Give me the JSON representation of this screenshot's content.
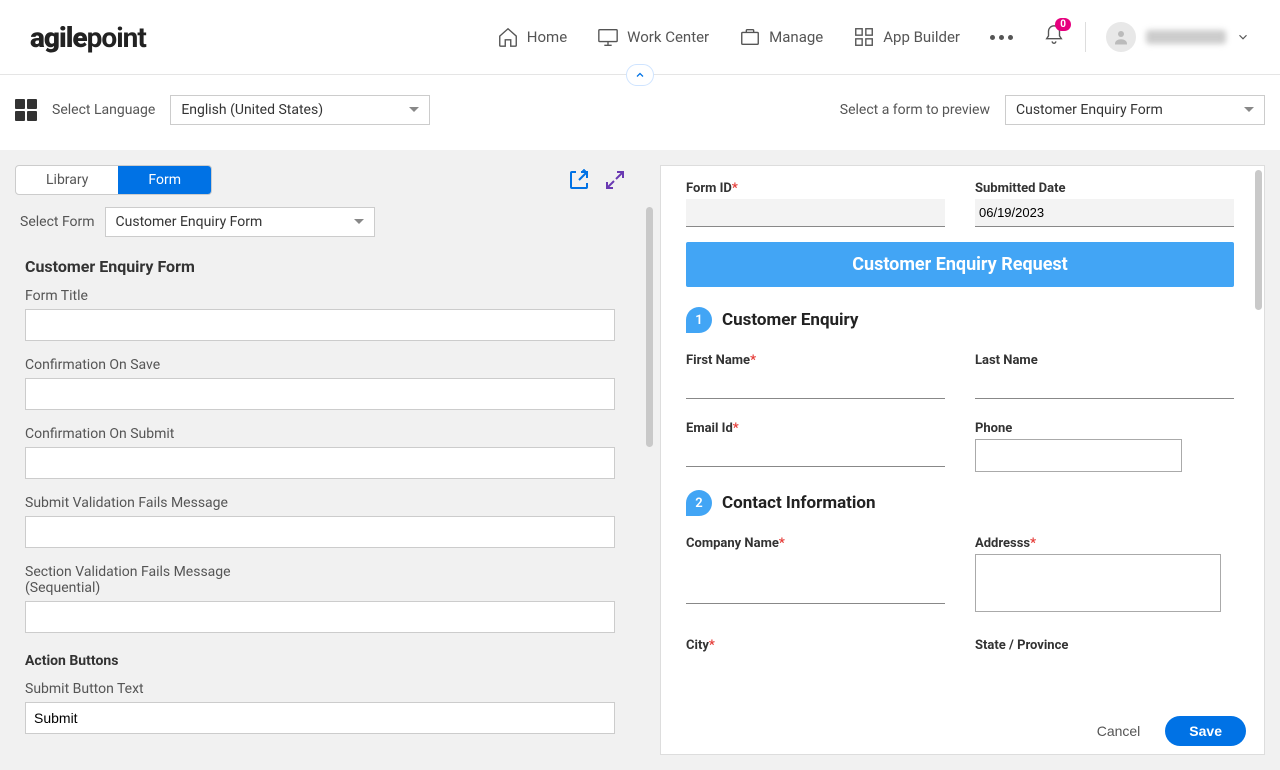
{
  "header": {
    "logo": "agilepoint",
    "nav": [
      "Home",
      "Work Center",
      "Manage",
      "App Builder"
    ],
    "notif_count": "0"
  },
  "subbar": {
    "lang_label": "Select Language",
    "lang_value": "English (United States)",
    "preview_label": "Select a form to preview",
    "preview_value": "Customer Enquiry Form"
  },
  "tabs": {
    "library": "Library",
    "form": "Form"
  },
  "left": {
    "select_form_label": "Select Form",
    "select_form_value": "Customer Enquiry Form",
    "section_title": "Customer Enquiry Form",
    "fields": {
      "form_title": "Form Title",
      "conf_save": "Confirmation On Save",
      "conf_submit": "Confirmation On Submit",
      "submit_fail": "Submit Validation Fails Message",
      "section_fail_1": "Section Validation Fails Message",
      "section_fail_2": "(Sequential)"
    },
    "action_buttons": "Action Buttons",
    "submit_text_label": "Submit Button Text",
    "submit_text_value": "Submit"
  },
  "preview": {
    "form_id_label": "Form ID",
    "submitted_label": "Submitted Date",
    "submitted_value": "06/19/2023",
    "banner": "Customer Enquiry Request",
    "step1": "Customer Enquiry",
    "first_name": "First Name",
    "last_name": "Last Name",
    "email": "Email Id",
    "phone": "Phone",
    "step2": "Contact Information",
    "company": "Company Name",
    "address": "Addresss",
    "city": "City",
    "state": "State / Province"
  },
  "footer": {
    "cancel": "Cancel",
    "save": "Save"
  }
}
